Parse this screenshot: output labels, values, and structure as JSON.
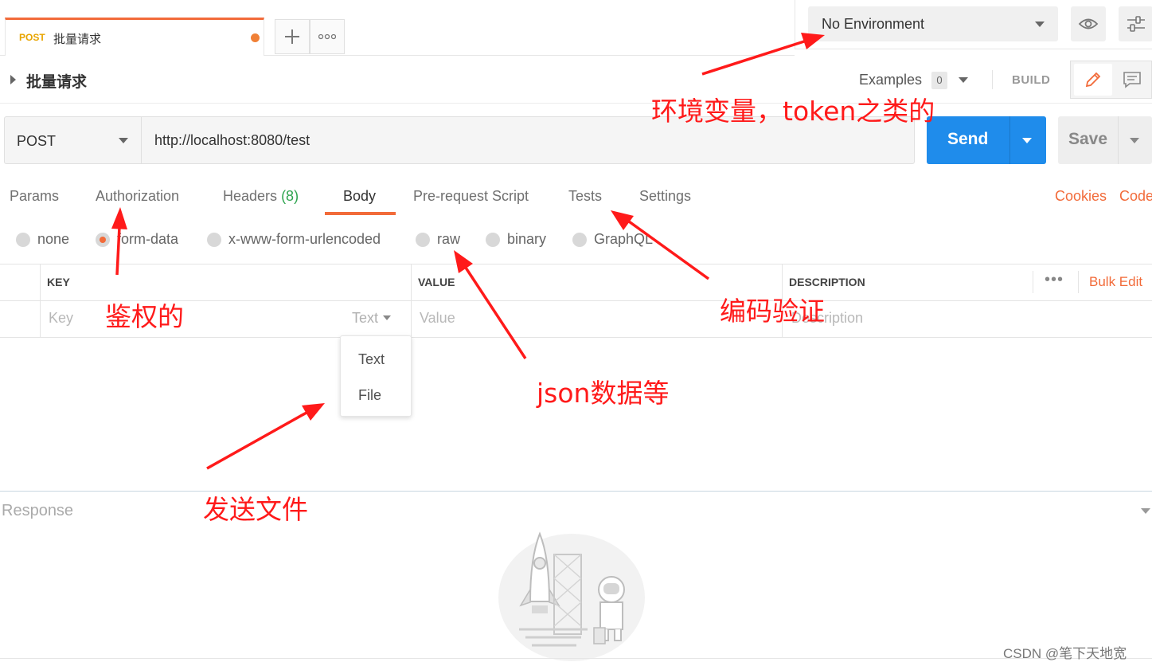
{
  "tab": {
    "method": "POST",
    "name": "批量请求"
  },
  "tab_buttons": {
    "add": "+",
    "more": "ooo"
  },
  "environment": {
    "selected": "No Environment"
  },
  "request": {
    "title": "批量请求",
    "examples_label": "Examples",
    "examples_count": "0",
    "build_label": "BUILD"
  },
  "url_bar": {
    "method": "POST",
    "url": "http://localhost:8080/test",
    "send_label": "Send",
    "save_label": "Save"
  },
  "request_tabs": {
    "params": "Params",
    "authorization": "Authorization",
    "headers": "Headers",
    "headers_count": "(8)",
    "body": "Body",
    "prerequest": "Pre-request Script",
    "tests": "Tests",
    "settings": "Settings",
    "cookies": "Cookies",
    "code": "Code"
  },
  "body_types": {
    "none": "none",
    "form_data": "form-data",
    "urlencoded": "x-www-form-urlencoded",
    "raw": "raw",
    "binary": "binary",
    "graphql": "GraphQL",
    "selected": "form-data"
  },
  "table": {
    "headers": {
      "key": "KEY",
      "value": "VALUE",
      "description": "DESCRIPTION"
    },
    "bulk_edit": "Bulk Edit",
    "more": "•••",
    "placeholders": {
      "key": "Key",
      "value": "Value",
      "description": "Description"
    },
    "type_value": "Text"
  },
  "type_menu": {
    "options": [
      "Text",
      "File"
    ]
  },
  "response": {
    "title": "Response"
  },
  "annotations": {
    "env": "环境变量，token之类的",
    "auth": "鉴权的",
    "raw": "json数据等",
    "tests": "编码验证",
    "file": "发送文件"
  },
  "watermark": "CSDN @笔下天地宽",
  "colors": {
    "accent": "#f26b3a",
    "send": "#1f8ceb",
    "annotation": "#ff1a1a",
    "post": "#e8a500"
  }
}
